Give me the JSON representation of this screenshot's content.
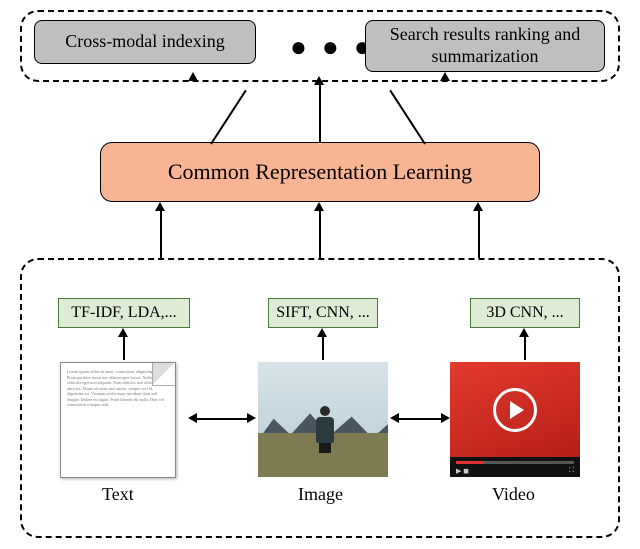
{
  "top": {
    "indexing": "Cross-modal indexing",
    "dots": "● ● ●",
    "ranking": "Search results ranking and summarization"
  },
  "crl": "Common Representation Learning",
  "features": {
    "text": "TF-IDF, LDA,...",
    "image": "SIFT, CNN, ...",
    "video": "3D CNN, ..."
  },
  "captions": {
    "text": "Text",
    "image": "Image",
    "video": "Video"
  },
  "doc_placeholder": "Lorem ipsum dolor sit amet, consectetur adipiscing elit. Proin porttitor tortor nec ullamcorper luctus. Nullam vehicula eget non aliquam. Nam ultricies non ullamcorper et ultricies. Donec sit amet nisi auctor, semper orci id, dignissim est. Vivamus scelerisque tincidunt risus sed feugiat. Dolore eu fugiat. Proin blandit elit nulla. Duis vel consectetur a neque velit."
}
